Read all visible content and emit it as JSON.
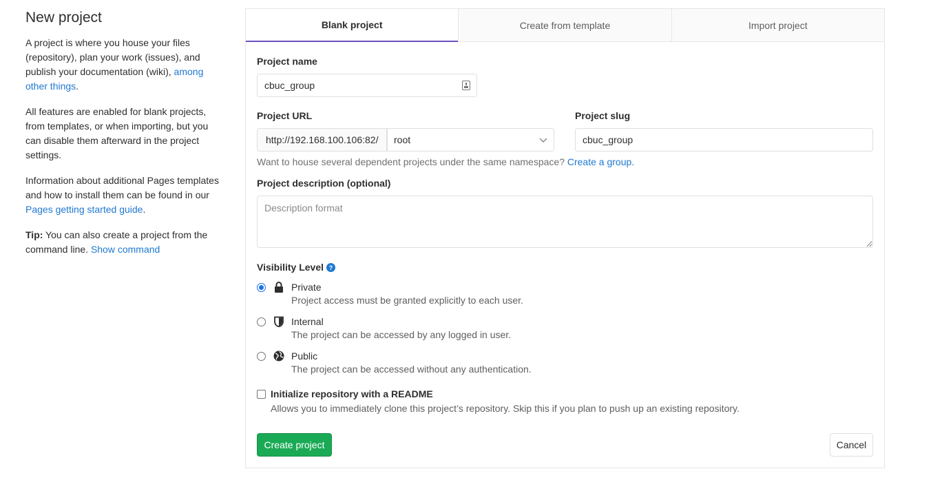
{
  "sidebar": {
    "title": "New project",
    "para1_text": "A project is where you house your files (repository), plan your work (issues), and publish your documentation (wiki), ",
    "para1_link": "among other things",
    "para1_end": ".",
    "para2": "All features are enabled for blank projects, from templates, or when importing, but you can disable them afterward in the project settings.",
    "para3_text": "Information about additional Pages templates and how to install them can be found in our ",
    "para3_link": "Pages getting started guide",
    "para3_end": ".",
    "tip_label": "Tip:",
    "tip_text": " You can also create a project from the command line. ",
    "tip_link": "Show command"
  },
  "tabs": [
    {
      "label": "Blank project"
    },
    {
      "label": "Create from template"
    },
    {
      "label": "Import project"
    }
  ],
  "form": {
    "project_name_label": "Project name",
    "project_name_value": "cbuc_group",
    "project_url_label": "Project URL",
    "url_prefix": "http://192.168.100.106:82/",
    "namespace_value": "root",
    "project_slug_label": "Project slug",
    "project_slug_value": "cbuc_group",
    "group_help_text": "Want to house several dependent projects under the same namespace? ",
    "group_help_link": "Create a group.",
    "description_label": "Project description (optional)",
    "description_placeholder": "Description format",
    "visibility_label": "Visibility Level",
    "visibility_options": [
      {
        "title": "Private",
        "desc": "Project access must be granted explicitly to each user.",
        "checked": true,
        "icon": "lock-icon"
      },
      {
        "title": "Internal",
        "desc": "The project can be accessed by any logged in user.",
        "checked": false,
        "icon": "shield-icon"
      },
      {
        "title": "Public",
        "desc": "The project can be accessed without any authentication.",
        "checked": false,
        "icon": "globe-icon"
      }
    ],
    "readme_label": "Initialize repository with a README",
    "readme_help": "Allows you to immediately clone this project’s repository. Skip this if you plan to push up an existing repository.",
    "create_button": "Create project",
    "cancel_button": "Cancel"
  },
  "colors": {
    "link": "#1f78d1",
    "primary_button": "#1aaa55",
    "active_tab_underline": "#6b4fbb"
  }
}
